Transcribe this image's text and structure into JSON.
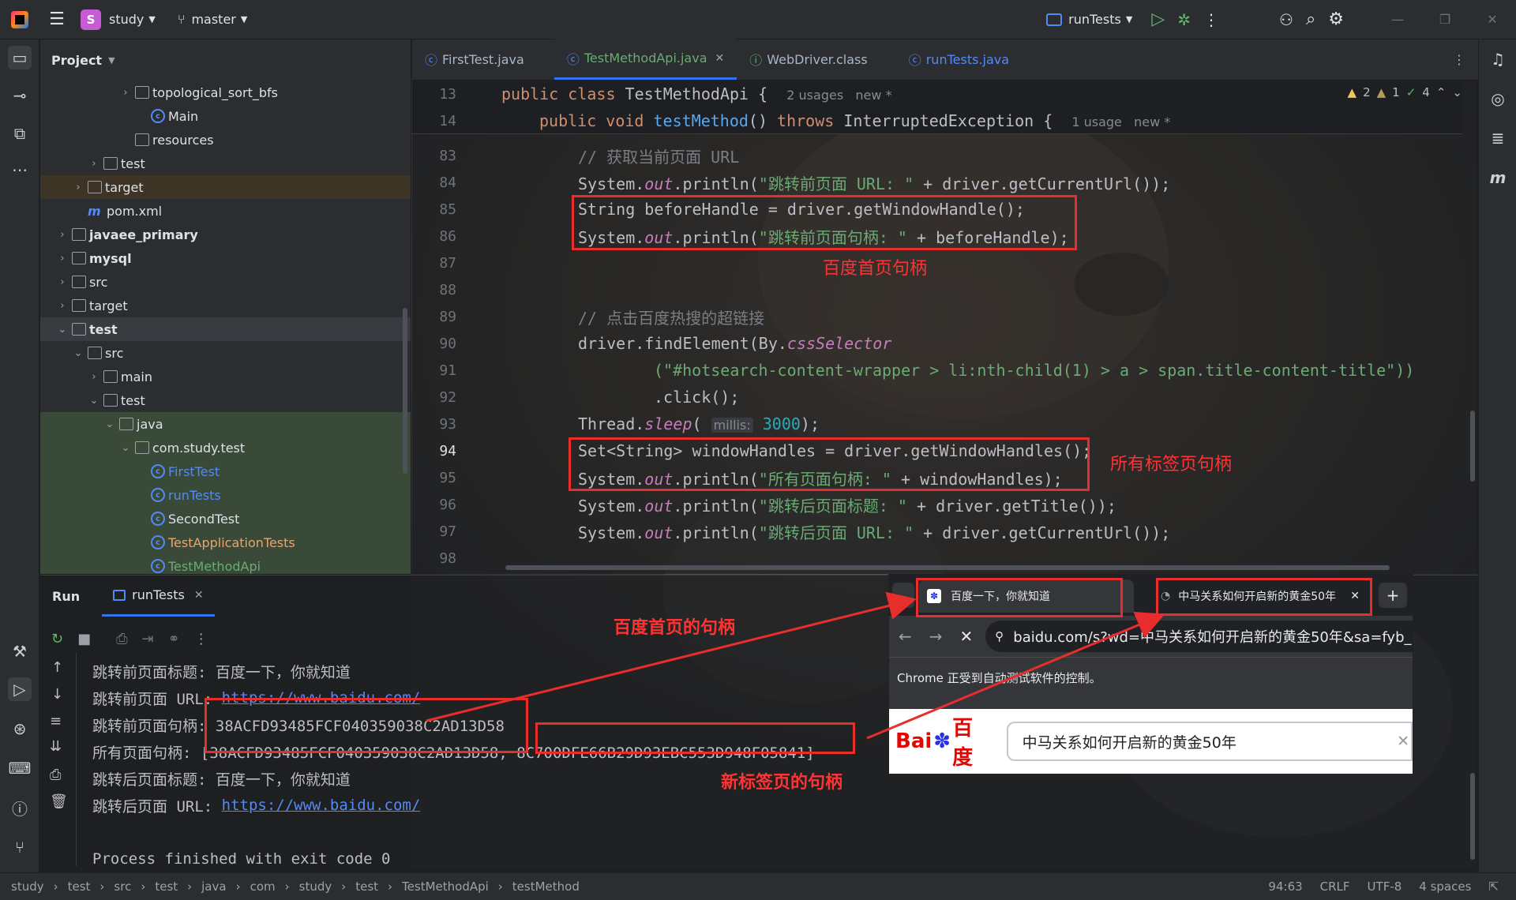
{
  "titlebar": {
    "project_badge": "S",
    "project": "study",
    "branch": "master",
    "run_config": "runTests"
  },
  "project_panel": {
    "title": "Project",
    "rows": [
      {
        "label": "topological_sort_bfs",
        "kind": "folder"
      },
      {
        "label": "Main",
        "kind": "class"
      },
      {
        "label": "resources",
        "kind": "folder"
      },
      {
        "label": "test",
        "kind": "folder"
      },
      {
        "label": "target",
        "kind": "folder"
      },
      {
        "label": "pom.xml",
        "kind": "maven"
      },
      {
        "label": "javaee_primary",
        "kind": "module"
      },
      {
        "label": "mysql",
        "kind": "module"
      },
      {
        "label": "src",
        "kind": "folder"
      },
      {
        "label": "target",
        "kind": "folder"
      },
      {
        "label": "test",
        "kind": "module"
      },
      {
        "label": "src",
        "kind": "folder"
      },
      {
        "label": "main",
        "kind": "folder"
      },
      {
        "label": "test",
        "kind": "folder"
      },
      {
        "label": "java",
        "kind": "folder"
      },
      {
        "label": "com.study.test",
        "kind": "package"
      },
      {
        "label": "FirstTest",
        "kind": "class"
      },
      {
        "label": "runTests",
        "kind": "class"
      },
      {
        "label": "SecondTest",
        "kind": "class"
      },
      {
        "label": "TestApplicationTests",
        "kind": "class"
      },
      {
        "label": "TestMethodApi",
        "kind": "class"
      }
    ]
  },
  "editor": {
    "tabs": [
      "FirstTest.java",
      "TestMethodApi.java",
      "WebDriver.class",
      "runTests.java"
    ],
    "inspections": {
      "warn1": "2",
      "warn2": "1",
      "ok": "4"
    },
    "sticky": [
      {
        "ln": "13",
        "text": "public class TestMethodApi {",
        "hint": "2 usages   new *"
      },
      {
        "ln": "14",
        "text": "public void testMethod() throws InterruptedException {",
        "hint": "1 usage   new *"
      }
    ],
    "lines": [
      {
        "ln": "83",
        "text": "// 获取当前页面 URL"
      },
      {
        "ln": "84",
        "text": "System.out.println(\"跳转前页面 URL: \" + driver.getCurrentUrl());"
      },
      {
        "ln": "85",
        "text": "String beforeHandle = driver.getWindowHandle();"
      },
      {
        "ln": "86",
        "text": "System.out.println(\"跳转前页面句柄: \" + beforeHandle);"
      },
      {
        "ln": "87",
        "text": ""
      },
      {
        "ln": "88",
        "text": ""
      },
      {
        "ln": "89",
        "text": "// 点击百度热搜的超链接"
      },
      {
        "ln": "90",
        "text": "driver.findElement(By.cssSelector"
      },
      {
        "ln": "91",
        "text": "(\"#hotsearch-content-wrapper > li:nth-child(1) > a > span.title-content-title\"))"
      },
      {
        "ln": "92",
        "text": ".click();"
      },
      {
        "ln": "93",
        "text": "Thread.sleep( millis: 3000);"
      },
      {
        "ln": "94",
        "text": "Set<String> windowHandles = driver.getWindowHandles();"
      },
      {
        "ln": "95",
        "text": "System.out.println(\"所有页面句柄: \" + windowHandles);"
      },
      {
        "ln": "96",
        "text": "System.out.println(\"跳转后页面标题: \" + driver.getTitle());"
      },
      {
        "ln": "97",
        "text": "System.out.println(\"跳转后页面 URL: \" + driver.getCurrentUrl());"
      },
      {
        "ln": "98",
        "text": ""
      }
    ]
  },
  "annotations": {
    "baidu_home_handle": "百度首页句柄",
    "all_tab_handles": "所有标签页句柄",
    "baidu_home_handle_2": "百度首页的句柄",
    "new_tab_handle": "新标签页的句柄"
  },
  "run": {
    "title": "Run",
    "tab": "runTests",
    "output": [
      "跳转前页面标题: 百度一下，你就知道",
      "跳转前页面 URL: ",
      "跳转前页面句柄: 38ACFD93485FCF040359038C2AD13D58",
      "所有页面句柄: [38ACFD93485FCF040359038C2AD13D58, 8C700DFE66B29D93EBC553D948F05841]",
      "跳转后页面标题: 百度一下，你就知道",
      "跳转后页面 URL: ",
      "",
      "Process finished with exit code 0"
    ],
    "url": "https://www.baidu.com/"
  },
  "browser": {
    "tab1": "百度一下，你就知道",
    "tab2": "中马关系如何开启新的黄金50年",
    "address": "baidu.com/s?wd=中马关系如何开启新的黄金50年&sa=fyb_",
    "notice": "Chrome 正受到自动测试软件的控制。",
    "search_value": "中马关系如何开启新的黄金50年",
    "logo": "Bai 百度"
  },
  "status": {
    "breadcrumb": [
      "study",
      "test",
      "src",
      "test",
      "java",
      "com",
      "study",
      "test",
      "TestMethodApi",
      "testMethod"
    ],
    "position": "94:63",
    "line_sep": "CRLF",
    "encoding": "UTF-8",
    "indent": "4 spaces"
  }
}
